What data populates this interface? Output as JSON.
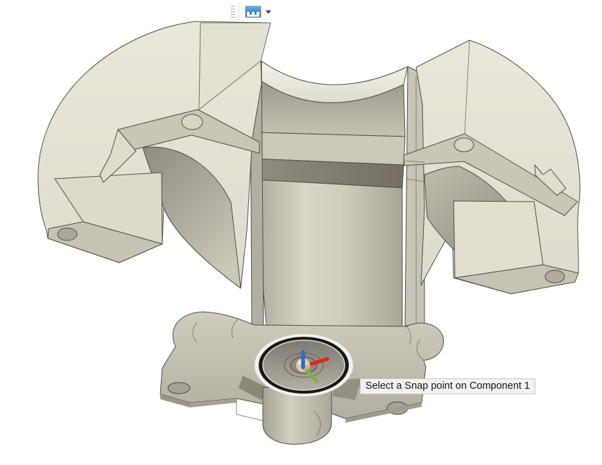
{
  "viewport": {
    "background": "#ffffff",
    "component_name": "Component 1"
  },
  "toolbar": {
    "icons": [
      {
        "name": "drag-handle-icon"
      },
      {
        "name": "snap-point-tool-icon"
      },
      {
        "name": "dropdown-caret-icon"
      }
    ],
    "accent_color": "#1976cf"
  },
  "tooltip": {
    "text": "Select a Snap point on Component 1",
    "background": "#f1f1f0",
    "text_color": "#161616"
  },
  "model": {
    "body_color": "#e7e4d7",
    "shade_color": "#c6c2b4",
    "shadow_color": "#8f8b80",
    "edge_color": "#4e4d47"
  },
  "snap_indicator": {
    "highlight_glow_color": "#f2f1eb",
    "highlight_ring_color": "#191917",
    "origin_knob_color": "#d9cfa8",
    "axes": {
      "x_color": "#d92b20",
      "y_color": "#7cb342",
      "z_color": "#2e68d8"
    }
  }
}
